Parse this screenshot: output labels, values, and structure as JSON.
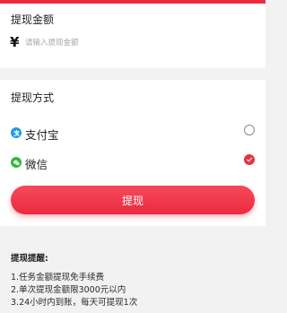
{
  "colors": {
    "accent": "#ee2a3c",
    "alipay_blue": "#1e9be9",
    "wechat_green": "#2dbb3a",
    "background": "#f2f2f2"
  },
  "amount": {
    "title": "提现金额",
    "currency_symbol": "¥",
    "input_value": "",
    "input_placeholder": "请输入提现金额"
  },
  "payment_method": {
    "title": "提现方式",
    "options": [
      {
        "label": "支付宝",
        "icon": "alipay-icon",
        "selected": false
      },
      {
        "label": "微信",
        "icon": "wechat-icon",
        "selected": true
      }
    ]
  },
  "submit": {
    "label": "提现"
  },
  "tips": {
    "title": "提现提醒:",
    "items": [
      "1.任务金额提现免手续费",
      "2.单次提现金额限3000元以内",
      "3.24小时内到账，每天可提现1次"
    ]
  }
}
